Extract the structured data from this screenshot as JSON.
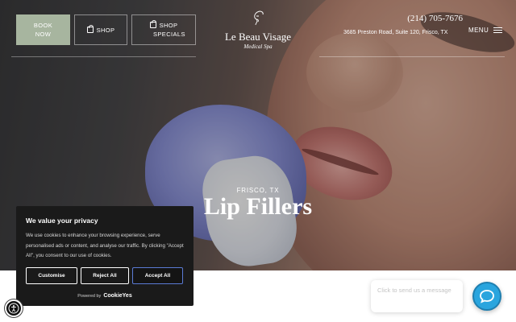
{
  "header": {
    "book_now_label": "BOOK NOW",
    "shop_label": "SHOP",
    "shop_specials_label": "SHOP SPECIALS",
    "logo_name": "Le Beau Visage",
    "logo_sub": "Medical Spa",
    "phone": "(214) 705-7676",
    "address": "3685 Preston Road, Suite 120, Frisco, TX",
    "menu_label": "MENU"
  },
  "hero": {
    "location": "FRISCO, TX",
    "title": "Lip Fillers"
  },
  "cookie_banner": {
    "title": "We value your privacy",
    "text": "We use cookies to enhance your browsing experience, serve personalised ads or content, and analyse our traffic. By clicking \"Accept All\", you consent to our use of cookies.",
    "customise_label": "Customise",
    "reject_label": "Reject All",
    "accept_label": "Accept All",
    "powered_label": "Powered by",
    "powered_brand": "CookieYes"
  },
  "chat": {
    "bubble_text": "Click to send us a message"
  },
  "colors": {
    "book_button": "#a7b59f",
    "chat_button": "#2aa5de",
    "accept_border": "#5b7bd5"
  },
  "icons": [
    "shopping-bag-icon",
    "hamburger-menu-icon",
    "accessibility-icon",
    "chat-icon",
    "logo-face-icon"
  ]
}
